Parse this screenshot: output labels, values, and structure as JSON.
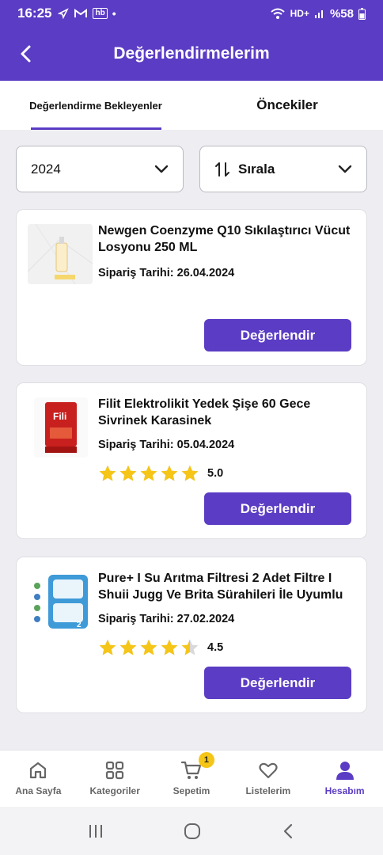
{
  "status_bar": {
    "time": "16:25",
    "hb": "hb",
    "dot": "•",
    "network": "HD+",
    "battery": "%58"
  },
  "header": {
    "title": "Değerlendirmelerim"
  },
  "tabs": [
    {
      "label": "Değerlendirme Bekleyenler",
      "active": true
    },
    {
      "label": "Öncekiler",
      "active": false
    }
  ],
  "filters": {
    "year": "2024",
    "sort_label": "Sırala"
  },
  "products": [
    {
      "name": "Newgen Coenzyme Q10 Sıkılaştırıcı Vücut Losyonu 250 ML",
      "date": "Sipariş Tarihi: 26.04.2024",
      "rating": null,
      "rating_text": "",
      "button": "Değerlendir"
    },
    {
      "name": "Filit Elektrolikit Yedek Şişe 60 Gece Sivrinek Karasinek",
      "date": "Sipariş Tarihi: 05.04.2024",
      "rating": 5.0,
      "rating_text": "5.0",
      "button": "Değerlendir"
    },
    {
      "name": "Pure+ I Su Arıtma Filtresi 2 Adet Filtre I Shuii Jugg Ve Brita Sürahileri İle Uyumlu",
      "date": "Sipariş Tarihi: 27.02.2024",
      "rating": 4.5,
      "rating_text": "4.5",
      "button": "Değerlendir"
    }
  ],
  "bottom_nav": [
    {
      "label": "Ana Sayfa",
      "icon": "home-icon"
    },
    {
      "label": "Kategoriler",
      "icon": "grid-icon"
    },
    {
      "label": "Sepetim",
      "icon": "cart-icon",
      "badge": "1"
    },
    {
      "label": "Listelerim",
      "icon": "heart-icon"
    },
    {
      "label": "Hesabım",
      "icon": "user-icon",
      "active": true
    }
  ],
  "colors": {
    "primary": "#5b3cc4",
    "star": "#f5c518",
    "background": "#eeeef2"
  }
}
